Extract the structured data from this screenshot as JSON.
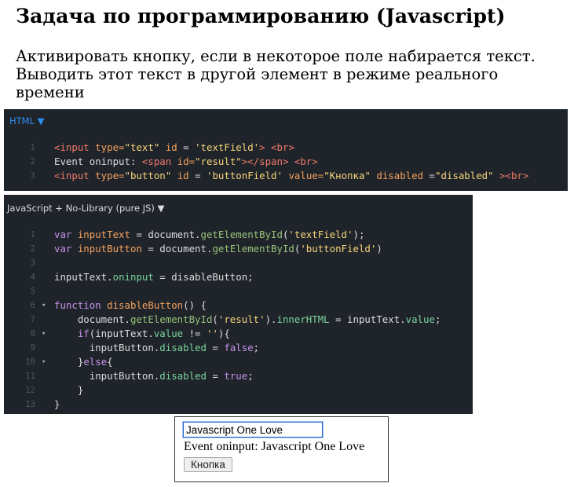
{
  "page": {
    "title": "Задача по программированию (Javascript)",
    "description": "Активировать кнопку, если в некоторое поле набирается текст. Выводить этот текст в другой элемент в режиме реального времени"
  },
  "html_panel": {
    "header": "HTML ▼",
    "lines": [
      {
        "n": "1",
        "fold": "",
        "tokens": [
          [
            "tag",
            "<input "
          ],
          [
            "attr",
            "type="
          ],
          [
            "str",
            "\"text\""
          ],
          [
            "plain",
            " "
          ],
          [
            "attr",
            "id"
          ],
          [
            "plain",
            " = "
          ],
          [
            "str",
            "'textField'"
          ],
          [
            "tag",
            "> <br>"
          ]
        ]
      },
      {
        "n": "2",
        "fold": "",
        "tokens": [
          [
            "plain",
            "Event oninput: "
          ],
          [
            "tag",
            "<span "
          ],
          [
            "attr",
            "id="
          ],
          [
            "str",
            "\"result\""
          ],
          [
            "tag",
            "></span> <br>"
          ]
        ]
      },
      {
        "n": "3",
        "fold": "",
        "tokens": [
          [
            "tag",
            "<input "
          ],
          [
            "attr",
            "type="
          ],
          [
            "str",
            "\"button\""
          ],
          [
            "plain",
            " "
          ],
          [
            "attr",
            "id"
          ],
          [
            "plain",
            " = "
          ],
          [
            "str",
            "'buttonField'"
          ],
          [
            "plain",
            " "
          ],
          [
            "attr",
            "value="
          ],
          [
            "str",
            "\"Кнопка\""
          ],
          [
            "plain",
            " "
          ],
          [
            "attr",
            "disabled"
          ],
          [
            "plain",
            " ="
          ],
          [
            "str",
            "\"disabled\""
          ],
          [
            "tag",
            " ><br>"
          ]
        ]
      }
    ]
  },
  "js_panel": {
    "header": "JavaScript + No-Library (pure JS) ▼",
    "lines": [
      {
        "n": "1",
        "fold": "",
        "tokens": [
          [
            "kw",
            "var "
          ],
          [
            "var",
            "inputText"
          ],
          [
            "plain",
            " = document."
          ],
          [
            "fn",
            "getElementById"
          ],
          [
            "plain",
            "("
          ],
          [
            "str",
            "'textField'"
          ],
          [
            "plain",
            ");"
          ]
        ]
      },
      {
        "n": "2",
        "fold": "",
        "tokens": [
          [
            "kw",
            "var "
          ],
          [
            "var",
            "inputButton"
          ],
          [
            "plain",
            " = document."
          ],
          [
            "fn",
            "getElementById"
          ],
          [
            "plain",
            "("
          ],
          [
            "str",
            "'buttonField'"
          ],
          [
            "plain",
            ")"
          ]
        ]
      },
      {
        "n": "3",
        "fold": "",
        "tokens": []
      },
      {
        "n": "4",
        "fold": "",
        "tokens": [
          [
            "plain",
            "inputText."
          ],
          [
            "prop",
            "oninput"
          ],
          [
            "plain",
            " = disableButton;"
          ]
        ]
      },
      {
        "n": "5",
        "fold": "",
        "tokens": []
      },
      {
        "n": "6",
        "fold": "▾",
        "tokens": [
          [
            "kw",
            "function "
          ],
          [
            "var",
            "disableButton"
          ],
          [
            "plain",
            "() {"
          ]
        ]
      },
      {
        "n": "7",
        "fold": "",
        "tokens": [
          [
            "plain",
            "    document."
          ],
          [
            "fn",
            "getElementById"
          ],
          [
            "plain",
            "("
          ],
          [
            "str",
            "'result'"
          ],
          [
            "plain",
            ")."
          ],
          [
            "prop",
            "innerHTML"
          ],
          [
            "plain",
            " = inputText."
          ],
          [
            "prop",
            "value"
          ],
          [
            "plain",
            ";"
          ]
        ]
      },
      {
        "n": "8",
        "fold": "▾",
        "tokens": [
          [
            "plain",
            "    "
          ],
          [
            "kw",
            "if"
          ],
          [
            "plain",
            "(inputText."
          ],
          [
            "prop",
            "value"
          ],
          [
            "plain",
            " != "
          ],
          [
            "str",
            "''"
          ],
          [
            "plain",
            "){"
          ]
        ]
      },
      {
        "n": "9",
        "fold": "",
        "tokens": [
          [
            "plain",
            "      inputButton."
          ],
          [
            "prop",
            "disabled"
          ],
          [
            "plain",
            " = "
          ],
          [
            "bool",
            "false"
          ],
          [
            "plain",
            ";"
          ]
        ]
      },
      {
        "n": "10",
        "fold": "▾",
        "tokens": [
          [
            "plain",
            "    }"
          ],
          [
            "kw",
            "else"
          ],
          [
            "plain",
            "{"
          ]
        ]
      },
      {
        "n": "11",
        "fold": "",
        "tokens": [
          [
            "plain",
            "      inputButton."
          ],
          [
            "prop",
            "disabled"
          ],
          [
            "plain",
            " = "
          ],
          [
            "bool",
            "true"
          ],
          [
            "plain",
            ";"
          ]
        ]
      },
      {
        "n": "12",
        "fold": "",
        "tokens": [
          [
            "plain",
            "    }"
          ]
        ]
      },
      {
        "n": "13",
        "fold": "",
        "tokens": [
          [
            "plain",
            "}"
          ]
        ]
      }
    ]
  },
  "demo": {
    "input_value": "Javascript One Love",
    "result_label": "Event oninput: Javascript One Love",
    "button_label": "Кнопка"
  }
}
